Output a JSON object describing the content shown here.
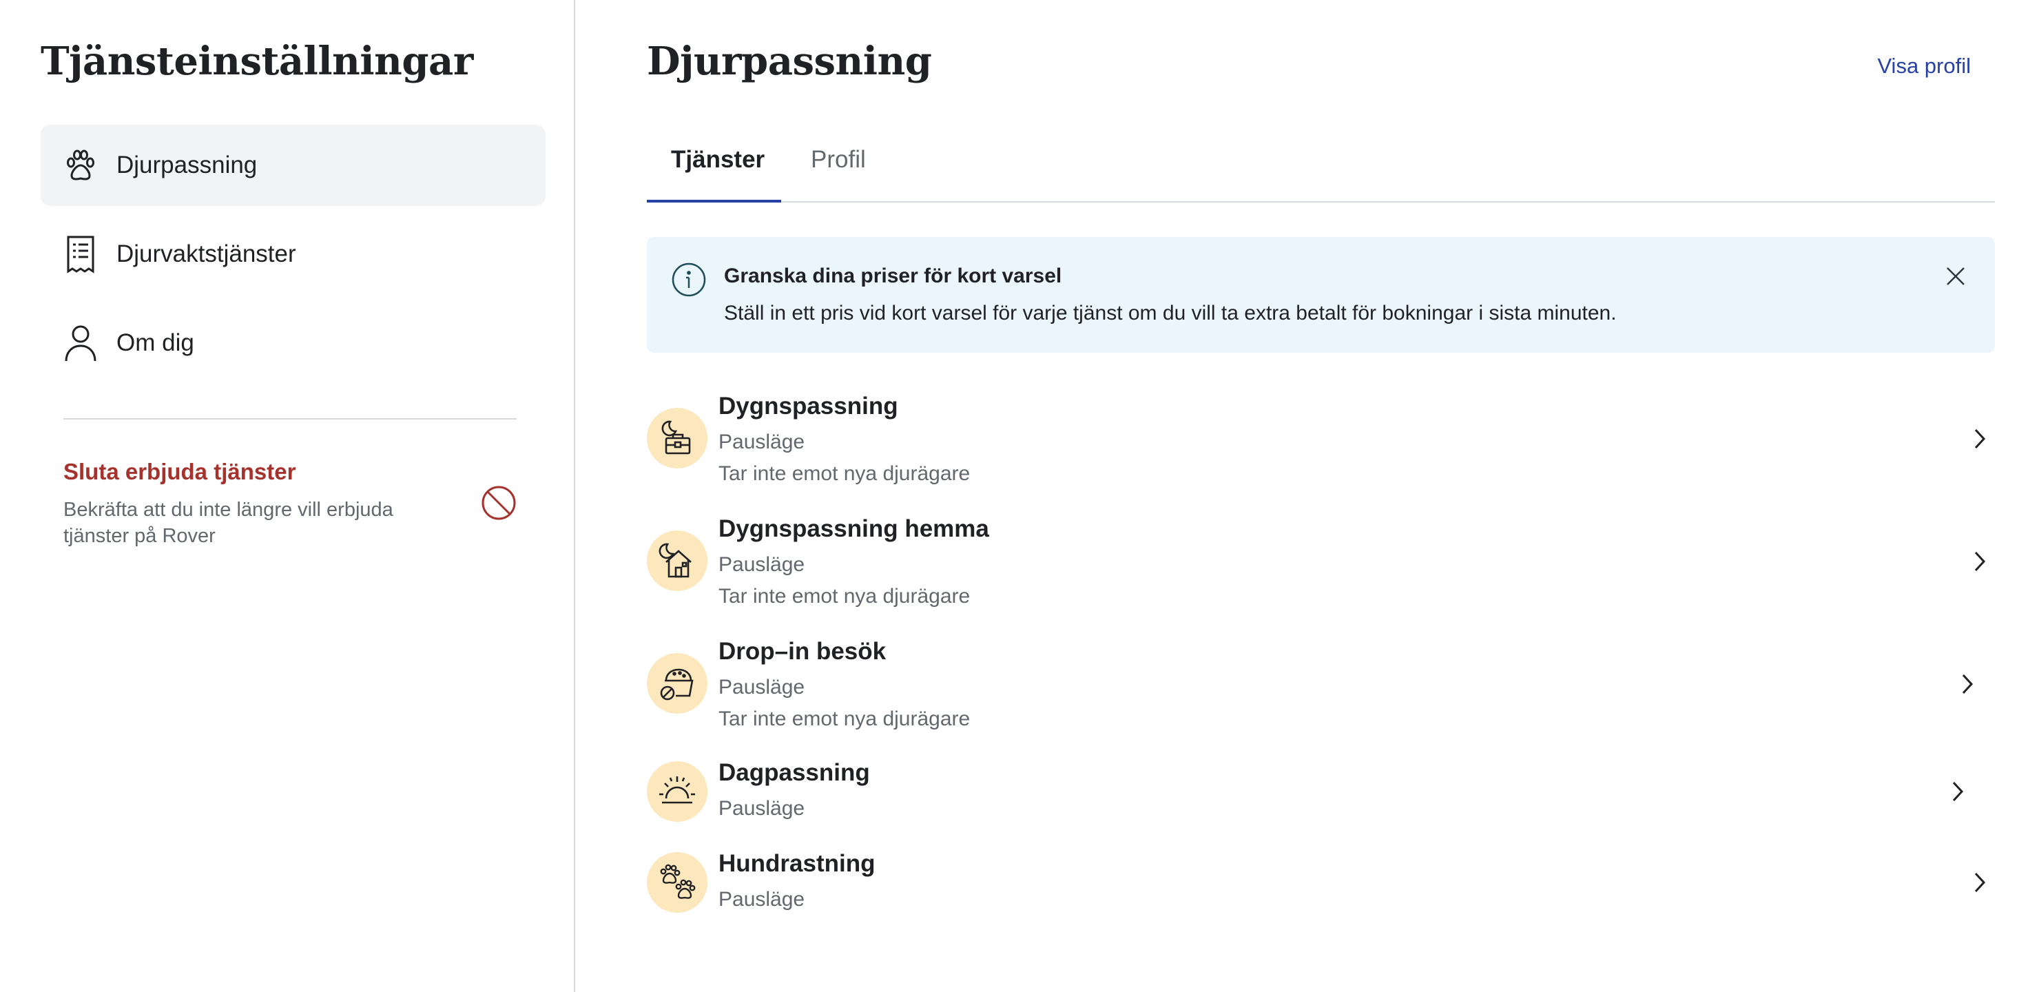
{
  "sidebar": {
    "title": "Tjänsteinställningar",
    "items": [
      {
        "label": "Djurpassning",
        "icon": "paw-icon",
        "active": true
      },
      {
        "label": "Djurvaktstjänster",
        "icon": "receipt-icon",
        "active": false
      },
      {
        "label": "Om dig",
        "icon": "user-icon",
        "active": false
      }
    ],
    "stop_offering": {
      "title": "Sluta erbjuda tjänster",
      "description": "Bekräfta att du inte längre vill erbjuda tjänster på Rover",
      "icon": "prohibited-icon"
    }
  },
  "main": {
    "title": "Djurpassning",
    "view_profile": "Visa profil",
    "tabs": [
      {
        "label": "Tjänster",
        "active": true
      },
      {
        "label": "Profil",
        "active": false
      }
    ],
    "banner": {
      "title": "Granska dina priser för kort varsel",
      "text": "Ställ in ett pris vid kort varsel för varje tjänst om du vill ta extra betalt för bokningar i sista minuten."
    },
    "services": [
      {
        "name": "Dygnspassning",
        "status": "Pausläge",
        "note": "Tar inte emot nya djurägare",
        "icon": "moon-suitcase-icon"
      },
      {
        "name": "Dygnspassning hemma",
        "status": "Pausläge",
        "note": "Tar inte emot nya djurägare",
        "icon": "moon-house-icon"
      },
      {
        "name": "Drop–in besök",
        "status": "Pausläge",
        "note": "Tar inte emot nya djurägare",
        "icon": "food-bowl-icon"
      },
      {
        "name": "Dagpassning",
        "status": "Pausläge",
        "note": "",
        "icon": "sunrise-icon"
      },
      {
        "name": "Hundrastning",
        "status": "Pausläge",
        "note": "",
        "icon": "paw-prints-icon"
      }
    ]
  },
  "colors": {
    "accent_blue": "#2741a5",
    "danger_red": "#a6322d",
    "banner_bg": "#eaf6fb",
    "service_icon_bg": "#fde7bd",
    "active_nav_bg": "#f2f3f5"
  }
}
